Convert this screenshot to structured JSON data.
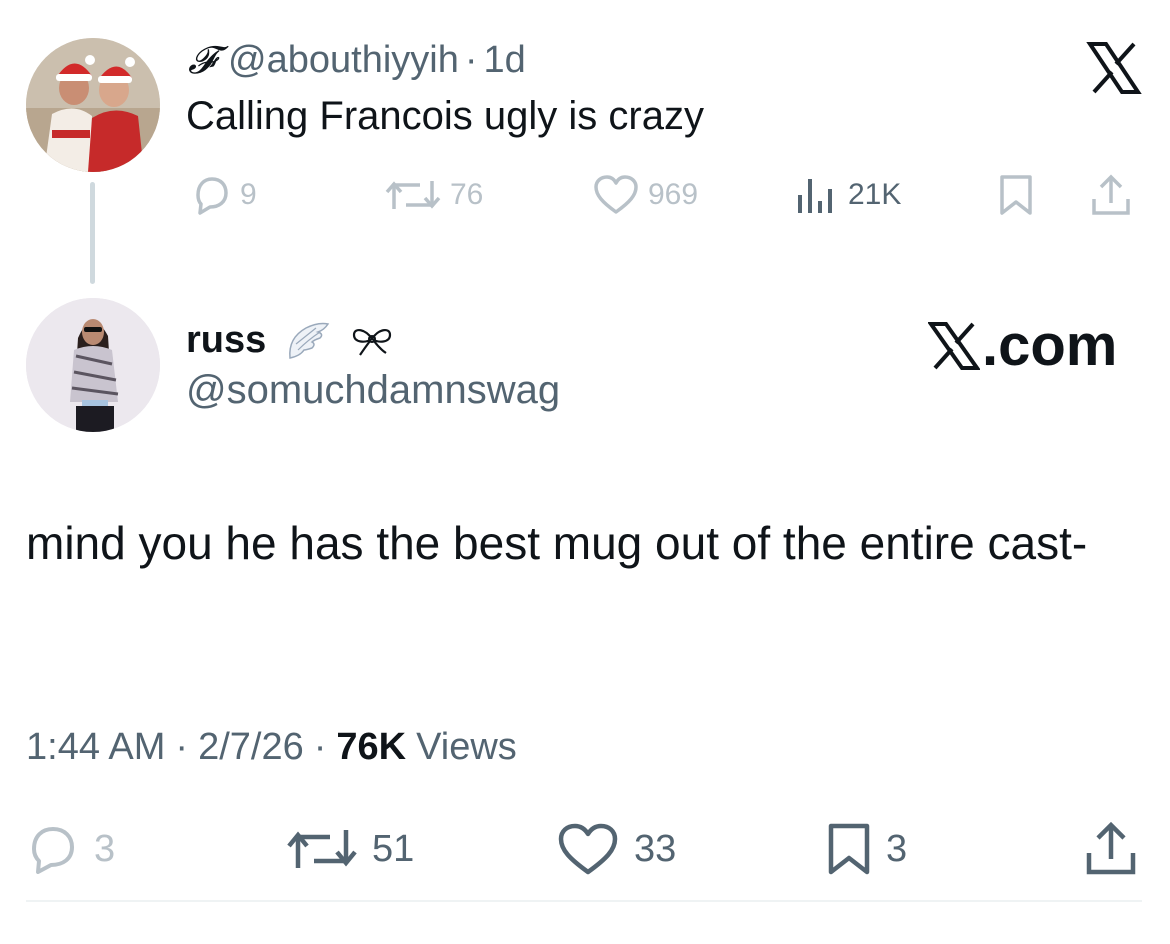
{
  "parent_tweet": {
    "fancy_name": "𝓕",
    "handle": "@abouthiyyih",
    "separator": "·",
    "time_ago": "1d",
    "text": "Calling Francois ugly is crazy",
    "actions": {
      "replies": "9",
      "reposts": "76",
      "likes": "969",
      "views": "21K"
    }
  },
  "main_tweet": {
    "display_name": "russ",
    "name_emoji_1": "🪽",
    "name_emoji_2": "ꕤ",
    "handle": "@somuchdamnswag",
    "brand_label": ".com",
    "body": "mind you he has the best mug out of the entire cast-",
    "time": "1:44 AM",
    "date": "2/7/26",
    "separator": "·",
    "views_count": "76K",
    "views_label": "Views",
    "actions": {
      "replies": "3",
      "reposts": "51",
      "likes": "33",
      "bookmarks": "3"
    }
  },
  "colors": {
    "text_primary": "#0f1419",
    "text_secondary": "#536471",
    "text_faded": "#b8c1c8",
    "thread_line": "#cfd9de"
  }
}
